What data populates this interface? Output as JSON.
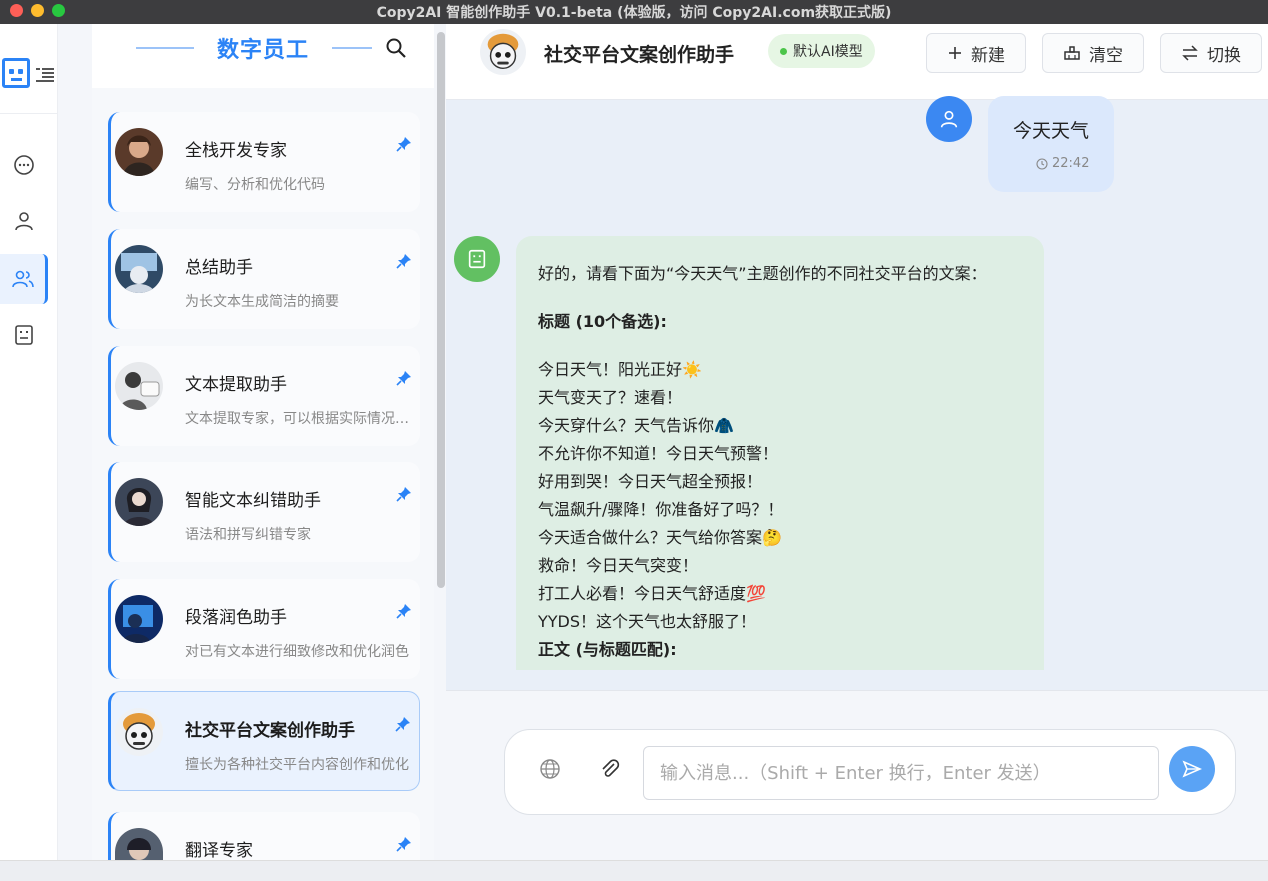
{
  "window": {
    "title": "Copy2AI 智能创作助手 V0.1-beta (体验版，访问 Copy2AI.com获取正式版)"
  },
  "sidebar": {
    "title": "数字员工",
    "agents": [
      {
        "name": "全栈开发专家",
        "desc": "编写、分析和优化代码"
      },
      {
        "name": "总结助手",
        "desc": "为长文本生成简洁的摘要"
      },
      {
        "name": "文本提取助手",
        "desc": "文本提取专家，可以根据实际情况提取需要的文本"
      },
      {
        "name": "智能文本纠错助手",
        "desc": "语法和拼写纠错专家"
      },
      {
        "name": "段落润色助手",
        "desc": "对已有文本进行细致修改和优化润色"
      },
      {
        "name": "社交平台文案创作助手",
        "desc": "擅长为各种社交平台内容创作和优化"
      },
      {
        "name": "翻译专家",
        "desc": ""
      }
    ]
  },
  "header": {
    "title": "社交平台文案创作助手",
    "model": "默认AI模型",
    "new_label": "新建",
    "clear_label": "清空",
    "switch_label": "切换"
  },
  "chat": {
    "user_message": "今天天气",
    "user_time": "22:42",
    "bot_intro": "好的，请看下面为“今天天气”主题创作的不同社交平台的文案：",
    "bot_heading": "标题 (10个备选):",
    "bot_lines": [
      "今日天气！阳光正好☀️",
      "天气变天了？速看！",
      "今天穿什么？天气告诉你🧥",
      "不允许你不知道！今日天气预警！",
      "好用到哭！今日天气超全预报！",
      "气温飙升/骤降！你准备好了吗？！",
      "今天适合做什么？天气给你答案🤔",
      "救命！今日天气突变！",
      "打工人必看！今日天气舒适度💯",
      "YYDS！这个天气也太舒服了！"
    ],
    "bot_body_heading": "正文 (与标题匹配):"
  },
  "composer": {
    "placeholder": "输入消息...（Shift + Enter 换行，Enter 发送）"
  },
  "colors": {
    "accent": "#2b83f6",
    "bot_bubble": "#deeee4",
    "user_bubble": "#dbe8fc",
    "bot_avatar": "#62c062"
  }
}
